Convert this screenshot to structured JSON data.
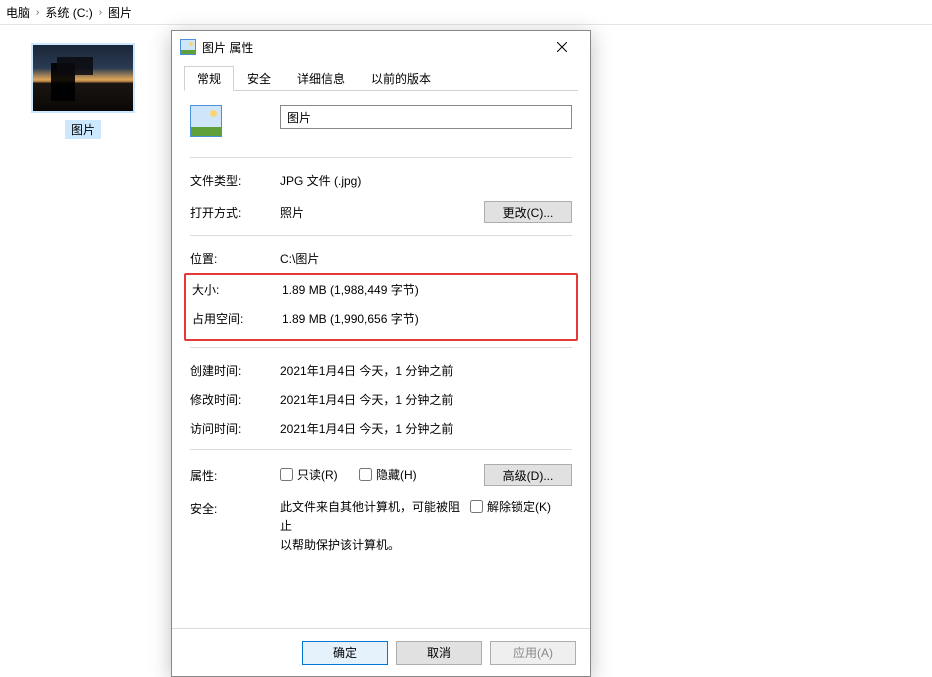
{
  "breadcrumb": {
    "seg1": "电脑",
    "seg2": "系统 (C:)",
    "seg3": "图片"
  },
  "file": {
    "name": "图片"
  },
  "dialog": {
    "title": "图片 属性",
    "tabs": {
      "general": "常规",
      "security": "安全",
      "details": "详细信息",
      "previous": "以前的版本"
    },
    "filename": "图片",
    "filetype_label": "文件类型:",
    "filetype_value": "JPG 文件 (.jpg)",
    "openwith_label": "打开方式:",
    "openwith_value": "照片",
    "change_btn": "更改(C)...",
    "location_label": "位置:",
    "location_value": "C:\\图片",
    "size_label": "大小:",
    "size_value": "1.89 MB (1,988,449 字节)",
    "sizeondisk_label": "占用空间:",
    "sizeondisk_value": "1.89 MB (1,990,656 字节)",
    "created_label": "创建时间:",
    "created_value": "2021年1月4日 今天，1 分钟之前",
    "modified_label": "修改时间:",
    "modified_value": "2021年1月4日 今天，1 分钟之前",
    "accessed_label": "访问时间:",
    "accessed_value": "2021年1月4日 今天，1 分钟之前",
    "attributes_label": "属性:",
    "readonly_label": "只读(R)",
    "hidden_label": "隐藏(H)",
    "advanced_btn": "高级(D)...",
    "security_label": "安全:",
    "security_text1": "此文件来自其他计算机，可能被阻止",
    "security_text2": "以帮助保护该计算机。",
    "unblock_label": "解除锁定(K)",
    "ok": "确定",
    "cancel": "取消",
    "apply": "应用(A)"
  }
}
